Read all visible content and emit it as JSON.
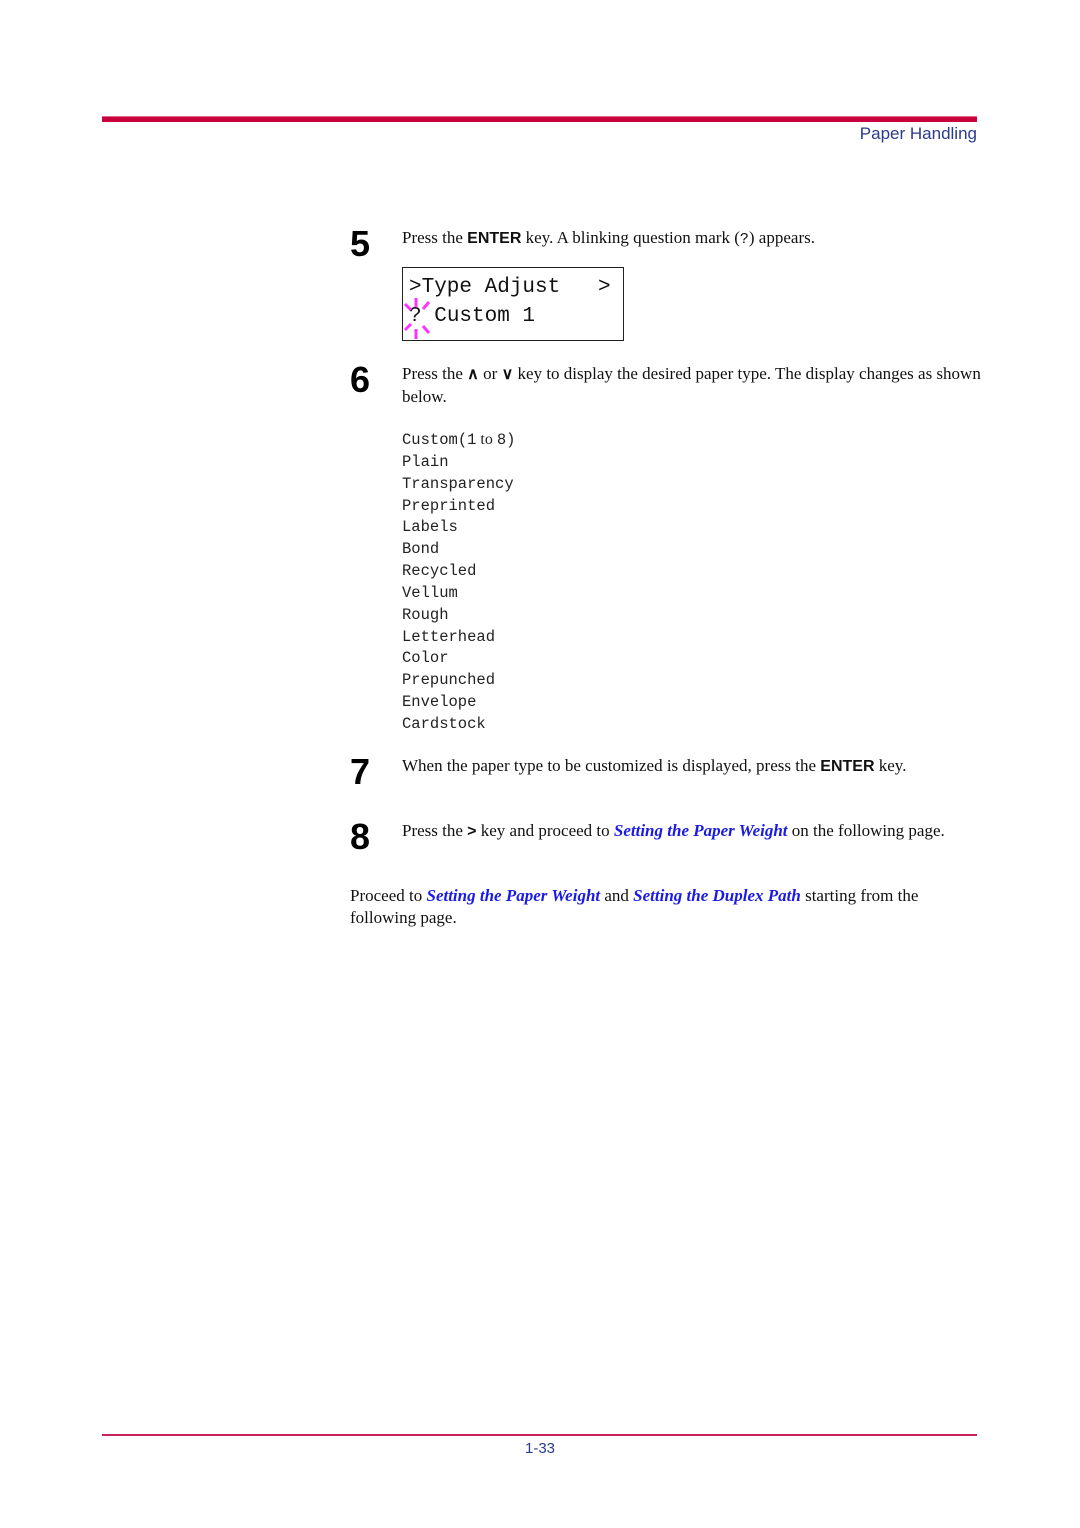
{
  "header": {
    "section_title": "Paper Handling"
  },
  "steps": [
    {
      "number": "5",
      "text_pre": "Press the ",
      "key": "ENTER",
      "text_mid": " key. A blinking question mark (",
      "symbol": "?",
      "text_post": ") appears."
    },
    {
      "number": "6",
      "text_pre": "Press the ",
      "up_key": "∧",
      "text_or": " or ",
      "down_key": "∨",
      "text_post": " key to display the desired paper type. The display changes as shown below."
    },
    {
      "number": "7",
      "text_pre": "When the paper type to be customized is displayed, press the ",
      "key": "ENTER",
      "text_post": " key."
    },
    {
      "number": "8",
      "text_pre": "Press the ",
      "key": ">",
      "text_mid": " key and proceed to ",
      "link": "Setting the Paper Weight",
      "text_post": " on the following page."
    }
  ],
  "lcd": {
    "line1": ">Type Adjust   >",
    "line2_symbol": "?",
    "line2": " Custom 1",
    "blink_color": "#ff33ff"
  },
  "paper_types": {
    "custom_label": "Custom",
    "custom_range_open": "(1",
    "custom_range_to": " to ",
    "custom_range_close": "8)",
    "items": [
      "Plain",
      "Transparency",
      "Preprinted",
      "Labels",
      "Bond",
      "Recycled",
      "Vellum",
      "Rough",
      "Letterhead",
      "Color",
      "Prepunched",
      "Envelope",
      "Cardstock"
    ]
  },
  "closing": {
    "text_pre": "Proceed to ",
    "link1": "Setting the Paper Weight",
    "text_and": " and ",
    "link2": "Setting the Duplex Path",
    "text_post": " starting from the following page."
  },
  "footer": {
    "page_number": "1-33"
  },
  "colors": {
    "rule": "#c8003c",
    "header_text": "#2a3a8c",
    "link": "#1a1ae6"
  }
}
